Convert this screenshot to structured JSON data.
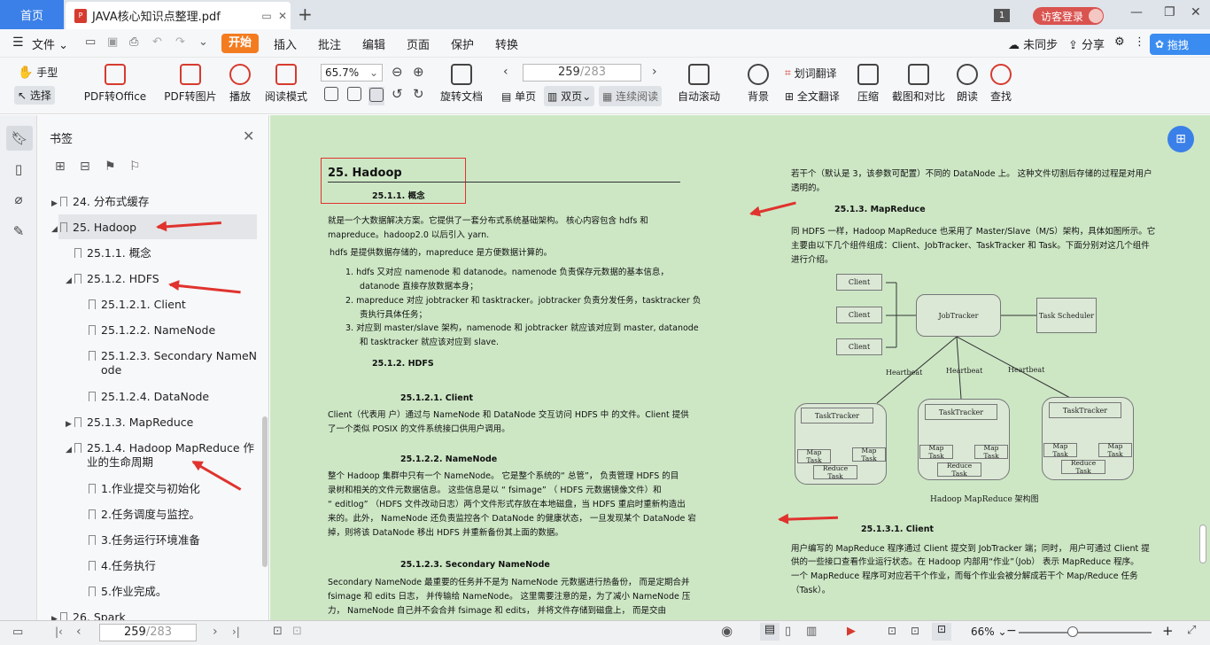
{
  "tabs": {
    "home": "首页",
    "doc_title": "JAVA核心知识点整理.pdf"
  },
  "titlebar": {
    "page_count_badge": "1",
    "guest_login": "访客登录"
  },
  "menu": {
    "file": "文件",
    "items": [
      "开始",
      "插入",
      "批注",
      "编辑",
      "页面",
      "保护",
      "转换"
    ],
    "sync": "未同步",
    "share": "分享",
    "drag": "拖拽"
  },
  "toolbar": {
    "hand": "手型",
    "select": "选择",
    "pdf_to_office": "PDF转Office",
    "pdf_to_image": "PDF转图片",
    "play": "播放",
    "read_mode": "阅读模式",
    "zoom": "65.7%",
    "rotate": "旋转文档",
    "page_current": "259",
    "page_total": "/283",
    "single": "单页",
    "double": "双页",
    "continuous": "连续阅读",
    "auto_scroll": "自动滚动",
    "background": "背景",
    "word_translate": "划词翻译",
    "full_translate": "全文翻译",
    "compress": "压缩",
    "screenshot_compare": "截图和对比",
    "read_aloud": "朗读",
    "search": "查找"
  },
  "panel": {
    "title": "书签",
    "items": [
      {
        "label": "24. 分布式缓存"
      },
      {
        "label": "25. Hadoop"
      },
      {
        "label": "25.1.1. 概念"
      },
      {
        "label": "25.1.2. HDFS"
      },
      {
        "label": "25.1.2.1.  Client"
      },
      {
        "label": "25.1.2.2.  NameNode"
      },
      {
        "label": "25.1.2.3. Secondary NameN"
      },
      {
        "label": "ode"
      },
      {
        "label": "25.1.2.4. DataNode"
      },
      {
        "label": "25.1.3. MapReduce"
      },
      {
        "label": "25.1.4. Hadoop MapReduce 作"
      },
      {
        "label": "业的生命周期"
      },
      {
        "label": "1.作业提交与初始化"
      },
      {
        "label": "2.任务调度与监控。"
      },
      {
        "label": "3.任务运行环境准备"
      },
      {
        "label": "4.任务执行"
      },
      {
        "label": "5.作业完成。"
      },
      {
        "label": "26. Spark"
      }
    ]
  },
  "doc": {
    "h25": "25.   Hadoop",
    "h2511": "25.1.1.     概念",
    "p1": "就是一个大数据解决方案。它提供了一套分布式系统基础架构。  核心内容包含 hdfs 和",
    "p1b": "mapreduce。hadoop2.0 以后引入 yarn.",
    "p2": "hdfs 是提供数据存储的，mapreduce 是方便数据计算的。",
    "l1": "1.    hdfs 又对应 namenode 和 datanode。namenode 负责保存元数据的基本信息，",
    "l1b": "datanode 直接存放数据本身；",
    "l2": "2.    mapreduce 对应 jobtracker 和 tasktracker。jobtracker 负责分发任务，tasktracker 负",
    "l2b": "责执行具体任务；",
    "l3": "3.    对应到 master/slave 架构，namenode 和 jobtracker 就应该对应到 master, datanode",
    "l3b": "和 tasktracker 就应该对应到 slave.",
    "h2512": "25.1.2.     HDFS",
    "h25121": "25.1.2.1.     Client",
    "pc1": "Client（代表用 户）通过与 NameNode 和 DataNode 交互访问 HDFS 中 的文件。Client 提供",
    "pc2": "了一个类似 POSIX 的文件系统接口供用户调用。",
    "h25122": "25.1.2.2.     NameNode",
    "pn1": "整个 Hadoop 集群中只有一个 NameNode。 它是整个系统的“ 总管”， 负责管理 HDFS 的目",
    "pn2": "录树和相关的文件元数据信息。 这些信息是以 “ fsimage” （ HDFS 元数据镜像文件）和",
    "pn3": "“ editlog” （HDFS 文件改动日志）两个文件形式存放在本地磁盘，当 HDFS 重启时重新构造出",
    "pn4": "来的。此外， NameNode 还负责监控各个 DataNode 的健康状态， 一旦发现某个 DataNode 宕",
    "pn5": "掉，则将该 DataNode 移出 HDFS 并重新备份其上面的数据。",
    "h25123": "25.1.2.3.     Secondary NameNode",
    "ps1": "Secondary NameNode 最重要的任务并不是为 NameNode 元数据进行热备份， 而是定期合并",
    "ps2": "fsimage 和 edits 日志， 并传输给 NameNode。 这里需要注意的是，为了减小 NameNode 压",
    "ps3": "力， NameNode 自己并不会合并 fsimage 和 edits， 并将文件存储到磁盘上， 而是交由",
    "r1": "若干个（默认是 3，该参数可配置）不同的 DataNode 上。 这种文件切割后存储的过程是对用户",
    "r2": "透明的。",
    "h2513": "25.1.3.     MapReduce",
    "rm1": "同 HDFS 一样，Hadoop MapReduce 也采用了 Master/Slave（M/S）架构，具体如图所示。它",
    "rm2": "主要由以下几个组件组成：Client、JobTracker、TaskTracker 和 Task。下面分别对这几个组件",
    "rm3": "进行介绍。",
    "h25131": "25.1.3.1.     Client",
    "rc1": "用户编写的 MapReduce 程序通过 Client 提交到 JobTracker 端；同时， 用户可通过 Client 提",
    "rc2": "供的一些接口查看作业运行状态。在 Hadoop 内部用“作业”（Job） 表示 MapReduce 程序。",
    "rc3": "一个 MapReduce 程序可对应若干个作业，而每个作业会被分解成若干个 Map/Reduce 任务",
    "rc4": "（Task）。"
  },
  "diagram": {
    "client": "Client",
    "jobtracker": "JobTracker",
    "task_scheduler": "Task Scheduler",
    "heartbeat": "Heartbeat",
    "tasktracker": "TaskTracker",
    "map_task": "Map Task",
    "reduce_task": "Reduce Task",
    "caption": "Hadoop MapReduce 架构图"
  },
  "status": {
    "page_current": "259",
    "page_total": "/283",
    "zoom": "66%"
  }
}
